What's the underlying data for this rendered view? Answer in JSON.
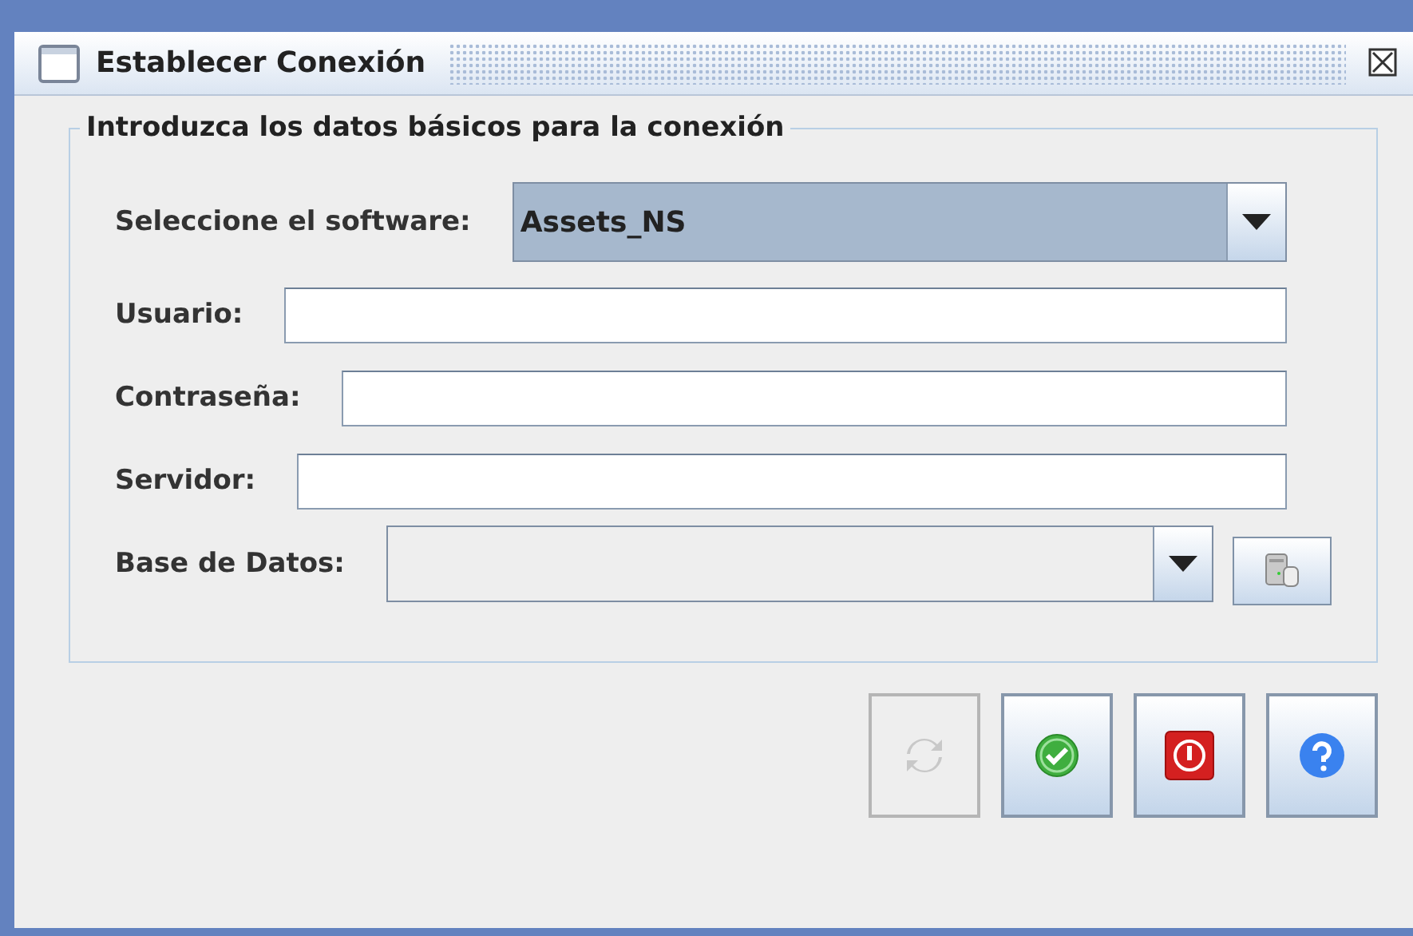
{
  "window": {
    "title": "Establecer Conexión"
  },
  "group": {
    "title": "Introduzca los datos básicos para la conexión"
  },
  "fields": [
    {
      "kind": "combo",
      "label": "Seleccione el software:",
      "value": "Assets_NS",
      "disabled": false
    },
    {
      "kind": "text",
      "label": "Usuario:"
    },
    {
      "kind": "text",
      "label": "Contraseña:"
    },
    {
      "kind": "text",
      "label": "Servidor:"
    },
    {
      "kind": "combo",
      "label": "Base de Datos:",
      "disabled": true,
      "side_button": true
    }
  ],
  "buttons": [
    {
      "kind": "refresh",
      "disabled": true
    },
    {
      "kind": "ok",
      "disabled": false
    },
    {
      "kind": "exit",
      "disabled": false
    },
    {
      "kind": "help",
      "disabled": false
    }
  ]
}
